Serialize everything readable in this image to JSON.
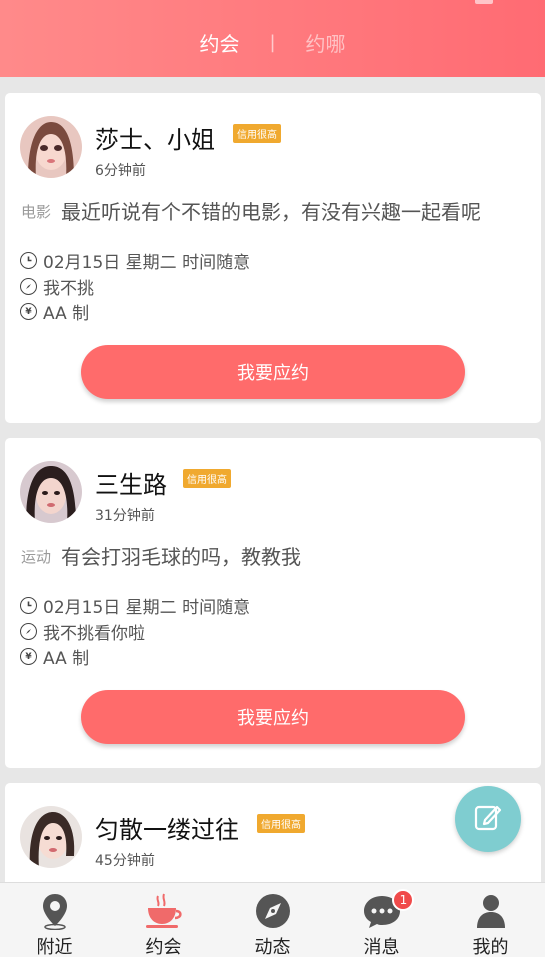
{
  "header": {
    "tab_active": "约会",
    "separator": "|",
    "tab_inactive": "约哪"
  },
  "cards": [
    {
      "name": "莎士、小姐",
      "badge": "信用很高",
      "time": "6分钟前",
      "category": "电影",
      "message": "最近听说有个不错的电影，有没有兴趣一起看呢",
      "datetime": "02月15日 星期二 时间随意",
      "location": "我不挑",
      "payment": "AA 制",
      "button": "我要应约"
    },
    {
      "name": "三生路",
      "badge": "信用很高",
      "time": "31分钟前",
      "category": "运动",
      "message": "有会打羽毛球的吗，教教我",
      "datetime": "02月15日 星期二 时间随意",
      "location": "我不挑看你啦",
      "payment": "AA 制",
      "button": "我要应约"
    },
    {
      "name": "匀散一缕过往",
      "badge": "信用很高",
      "time": "45分钟前"
    }
  ],
  "tabbar": {
    "items": [
      {
        "label": "附近",
        "icon": "location-pin-icon"
      },
      {
        "label": "约会",
        "icon": "coffee-cup-icon"
      },
      {
        "label": "动态",
        "icon": "compass-icon"
      },
      {
        "label": "消息",
        "icon": "chat-bubble-icon",
        "badge": "1"
      },
      {
        "label": "我的",
        "icon": "user-icon"
      }
    ]
  },
  "colors": {
    "accent": "#ff6b6b",
    "badge": "#f0a92f",
    "fab": "#7fcdd0",
    "active_tab_icon": "#f06a6a"
  }
}
